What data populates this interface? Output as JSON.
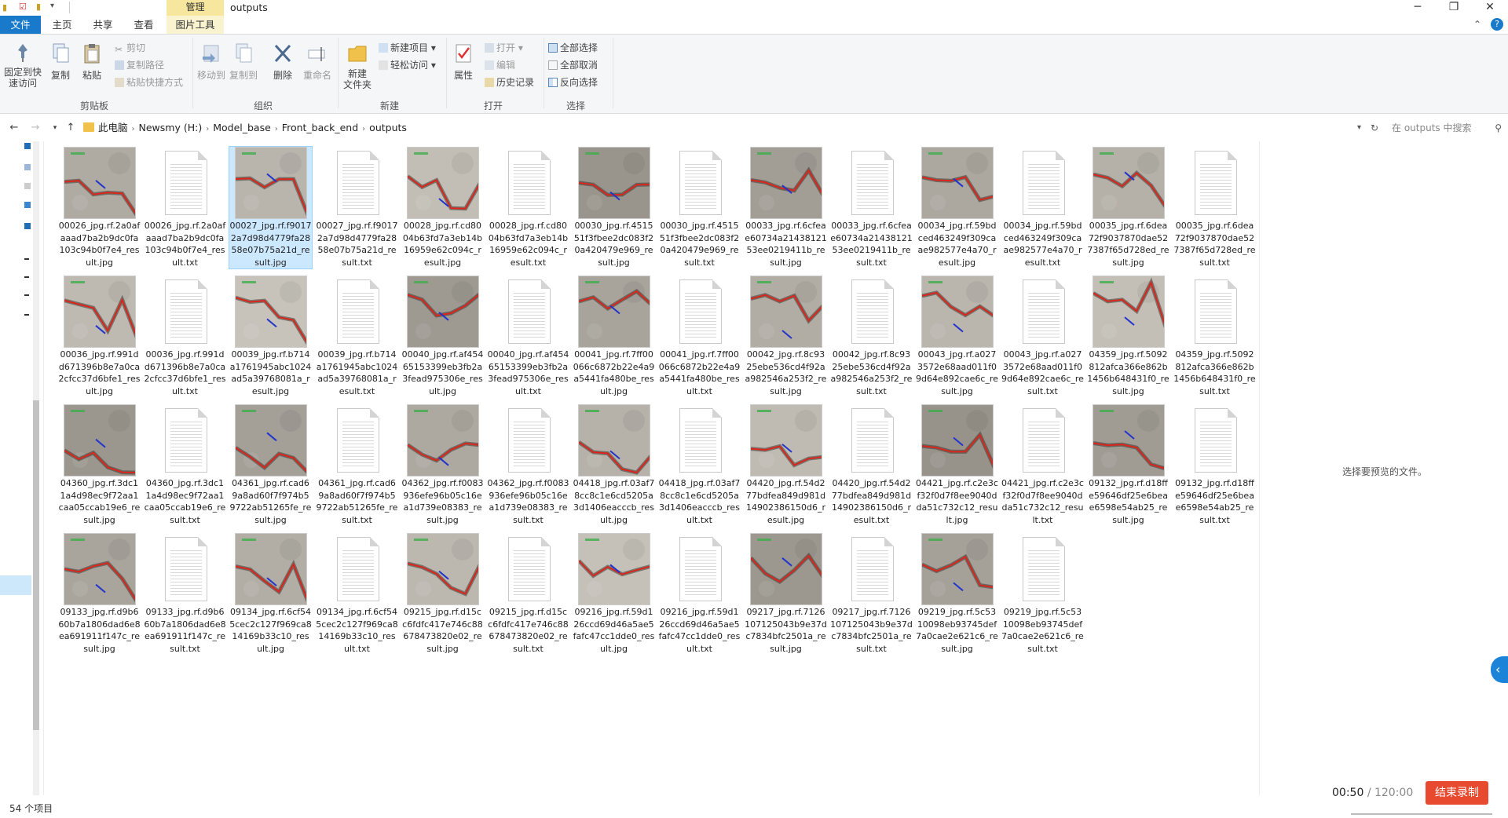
{
  "window": {
    "title": "outputs",
    "manage_tab": "管理",
    "controls": [
      "─",
      "❐",
      "✕"
    ]
  },
  "tabs": [
    "文件",
    "主页",
    "共享",
    "查看",
    "图片工具"
  ],
  "ribbon": {
    "clipboard": {
      "pin_label": "固定到快\n速访问",
      "copy_label": "复制",
      "paste_label": "粘贴",
      "cut_label": "剪切",
      "copy_path_label": "复制路径",
      "paste_shortcut_label": "粘贴快捷方式",
      "group_label": "剪贴板"
    },
    "organize": {
      "move_to_label": "移动到",
      "copy_to_label": "复制到",
      "delete_label": "删除",
      "rename_label": "重命名",
      "group_label": "组织"
    },
    "new": {
      "new_folder_label": "新建\n文件夹",
      "new_item_label": "新建项目",
      "easy_access_label": "轻松访问",
      "group_label": "新建"
    },
    "open": {
      "properties_label": "属性",
      "open_label": "打开",
      "edit_label": "编辑",
      "history_label": "历史记录",
      "group_label": "打开"
    },
    "select": {
      "select_all_label": "全部选择",
      "select_none_label": "全部取消",
      "invert_label": "反向选择",
      "group_label": "选择"
    }
  },
  "address": {
    "crumbs": [
      "此电脑",
      "Newsmy (H:)",
      "Model_base",
      "Front_back_end",
      "outputs"
    ],
    "search_placeholder": "在 outputs 中搜索"
  },
  "files": [
    {
      "name": "00026_jpg.rf.2a0afaaad7ba2b9dc0fa103c94b0f7e4_result.jpg",
      "type": "jpg"
    },
    {
      "name": "00026_jpg.rf.2a0afaaad7ba2b9dc0fa103c94b0f7e4_result.txt",
      "type": "txt"
    },
    {
      "name": "00027_jpg.rf.f90172a7d98d4779fa2858e07b75a21d_result.jpg",
      "type": "jpg",
      "selected": true
    },
    {
      "name": "00027_jpg.rf.f90172a7d98d4779fa2858e07b75a21d_result.txt",
      "type": "txt"
    },
    {
      "name": "00028_jpg.rf.cd8004b63fd7a3eb14b16959e62c094c_result.jpg",
      "type": "jpg"
    },
    {
      "name": "00028_jpg.rf.cd8004b63fd7a3eb14b16959e62c094c_result.txt",
      "type": "txt"
    },
    {
      "name": "00030_jpg.rf.451551f3fbee2dc083f20a420479e969_result.jpg",
      "type": "jpg"
    },
    {
      "name": "00030_jpg.rf.451551f3fbee2dc083f20a420479e969_result.txt",
      "type": "txt"
    },
    {
      "name": "00033_jpg.rf.6cfeae60734a2143812153ee0219411b_result.jpg",
      "type": "jpg"
    },
    {
      "name": "00033_jpg.rf.6cfeae60734a2143812153ee0219411b_result.txt",
      "type": "txt"
    },
    {
      "name": "00034_jpg.rf.59bdced463249f309caae982577e4a70_result.jpg",
      "type": "jpg"
    },
    {
      "name": "00034_jpg.rf.59bdced463249f309caae982577e4a70_result.txt",
      "type": "txt"
    },
    {
      "name": "00035_jpg.rf.6dea72f9037870dae527387f65d728ed_result.jpg",
      "type": "jpg"
    },
    {
      "name": "00035_jpg.rf.6dea72f9037870dae527387f65d728ed_result.txt",
      "type": "txt"
    },
    {
      "name": "00036_jpg.rf.991dd671396b8e7a0ca2cfcc37d6bfe1_result.jpg",
      "type": "jpg"
    },
    {
      "name": "00036_jpg.rf.991dd671396b8e7a0ca2cfcc37d6bfe1_result.txt",
      "type": "txt"
    },
    {
      "name": "00039_jpg.rf.b714a1761945abc1024ad5a39768081a_result.jpg",
      "type": "jpg"
    },
    {
      "name": "00039_jpg.rf.b714a1761945abc1024ad5a39768081a_result.txt",
      "type": "txt"
    },
    {
      "name": "00040_jpg.rf.af45465153399eb3fb2a3fead975306e_result.jpg",
      "type": "jpg"
    },
    {
      "name": "00040_jpg.rf.af45465153399eb3fb2a3fead975306e_result.txt",
      "type": "txt"
    },
    {
      "name": "00041_jpg.rf.7ff00066c6872b22e4a9a5441fa480be_result.jpg",
      "type": "jpg"
    },
    {
      "name": "00041_jpg.rf.7ff00066c6872b22e4a9a5441fa480be_result.txt",
      "type": "txt"
    },
    {
      "name": "00042_jpg.rf.8c9325ebe536cd4f92aa982546a253f2_result.jpg",
      "type": "jpg"
    },
    {
      "name": "00042_jpg.rf.8c9325ebe536cd4f92aa982546a253f2_result.txt",
      "type": "txt"
    },
    {
      "name": "00043_jpg.rf.a0273572e68aad011f09d64e892cae6c_result.jpg",
      "type": "jpg"
    },
    {
      "name": "00043_jpg.rf.a0273572e68aad011f09d64e892cae6c_result.txt",
      "type": "txt"
    },
    {
      "name": "04359_jpg.rf.5092812afca366e862b1456b648431f0_result.jpg",
      "type": "jpg"
    },
    {
      "name": "04359_jpg.rf.5092812afca366e862b1456b648431f0_result.txt",
      "type": "txt"
    },
    {
      "name": "04360_jpg.rf.3dc11a4d98ec9f72aa1caa05ccab19e6_result.jpg",
      "type": "jpg"
    },
    {
      "name": "04360_jpg.rf.3dc11a4d98ec9f72aa1caa05ccab19e6_result.txt",
      "type": "txt"
    },
    {
      "name": "04361_jpg.rf.cad69a8ad60f7f974b59722ab51265fe_result.jpg",
      "type": "jpg"
    },
    {
      "name": "04361_jpg.rf.cad69a8ad60f7f974b59722ab51265fe_result.txt",
      "type": "txt"
    },
    {
      "name": "04362_jpg.rf.f0083936efe96b05c16ea1d739e08383_result.jpg",
      "type": "jpg"
    },
    {
      "name": "04362_jpg.rf.f0083936efe96b05c16ea1d739e08383_result.txt",
      "type": "txt"
    },
    {
      "name": "04418_jpg.rf.03af78cc8c1e6cd5205a3d1406eacccb_result.jpg",
      "type": "jpg"
    },
    {
      "name": "04418_jpg.rf.03af78cc8c1e6cd5205a3d1406eacccb_result.txt",
      "type": "txt"
    },
    {
      "name": "04420_jpg.rf.54d277bdfea849d981d14902386150d6_result.jpg",
      "type": "jpg"
    },
    {
      "name": "04420_jpg.rf.54d277bdfea849d981d14902386150d6_result.txt",
      "type": "txt"
    },
    {
      "name": "04421_jpg.rf.c2e3cf32f0d7f8ee9040dda51c732c12_result.jpg",
      "type": "jpg"
    },
    {
      "name": "04421_jpg.rf.c2e3cf32f0d7f8ee9040dda51c732c12_result.txt",
      "type": "txt"
    },
    {
      "name": "09132_jpg.rf.d18ffe59646df25e6beae6598e54ab25_result.jpg",
      "type": "jpg"
    },
    {
      "name": "09132_jpg.rf.d18ffe59646df25e6beae6598e54ab25_result.txt",
      "type": "txt"
    },
    {
      "name": "09133_jpg.rf.d9b660b7a1806dad6e8ea691911f147c_result.jpg",
      "type": "jpg"
    },
    {
      "name": "09133_jpg.rf.d9b660b7a1806dad6e8ea691911f147c_result.txt",
      "type": "txt"
    },
    {
      "name": "09134_jpg.rf.6cf545cec2c127f969ca814169b33c10_result.jpg",
      "type": "jpg"
    },
    {
      "name": "09134_jpg.rf.6cf545cec2c127f969ca814169b33c10_result.txt",
      "type": "txt"
    },
    {
      "name": "09215_jpg.rf.d15cc6fdfc417e746c88678473820e02_result.jpg",
      "type": "jpg"
    },
    {
      "name": "09215_jpg.rf.d15cc6fdfc417e746c88678473820e02_result.txt",
      "type": "txt"
    },
    {
      "name": "09216_jpg.rf.59d126ccd69d46a5ae5fafc47cc1dde0_result.jpg",
      "type": "jpg"
    },
    {
      "name": "09216_jpg.rf.59d126ccd69d46a5ae5fafc47cc1dde0_result.txt",
      "type": "txt"
    },
    {
      "name": "09217_jpg.rf.7126107125043b9e37dc7834bfc2501a_result.jpg",
      "type": "jpg"
    },
    {
      "name": "09217_jpg.rf.7126107125043b9e37dc7834bfc2501a_result.txt",
      "type": "txt"
    },
    {
      "name": "09219_jpg.rf.5c5310098eb93745def7a0cae2e621c6_result.jpg",
      "type": "jpg"
    },
    {
      "name": "09219_jpg.rf.5c5310098eb93745def7a0cae2e621c6_result.txt",
      "type": "txt"
    }
  ],
  "preview_message": "选择要预览的文件。",
  "status": {
    "item_count": "54 个项目"
  },
  "recorder": {
    "elapsed": "00:50",
    "total": "/ 120:00",
    "stop_label": "结束录制"
  },
  "colors": {
    "accent": "#1979ca",
    "manage": "#f7e79e",
    "record": "#e84a2f",
    "crack_line": "#d8261e"
  }
}
